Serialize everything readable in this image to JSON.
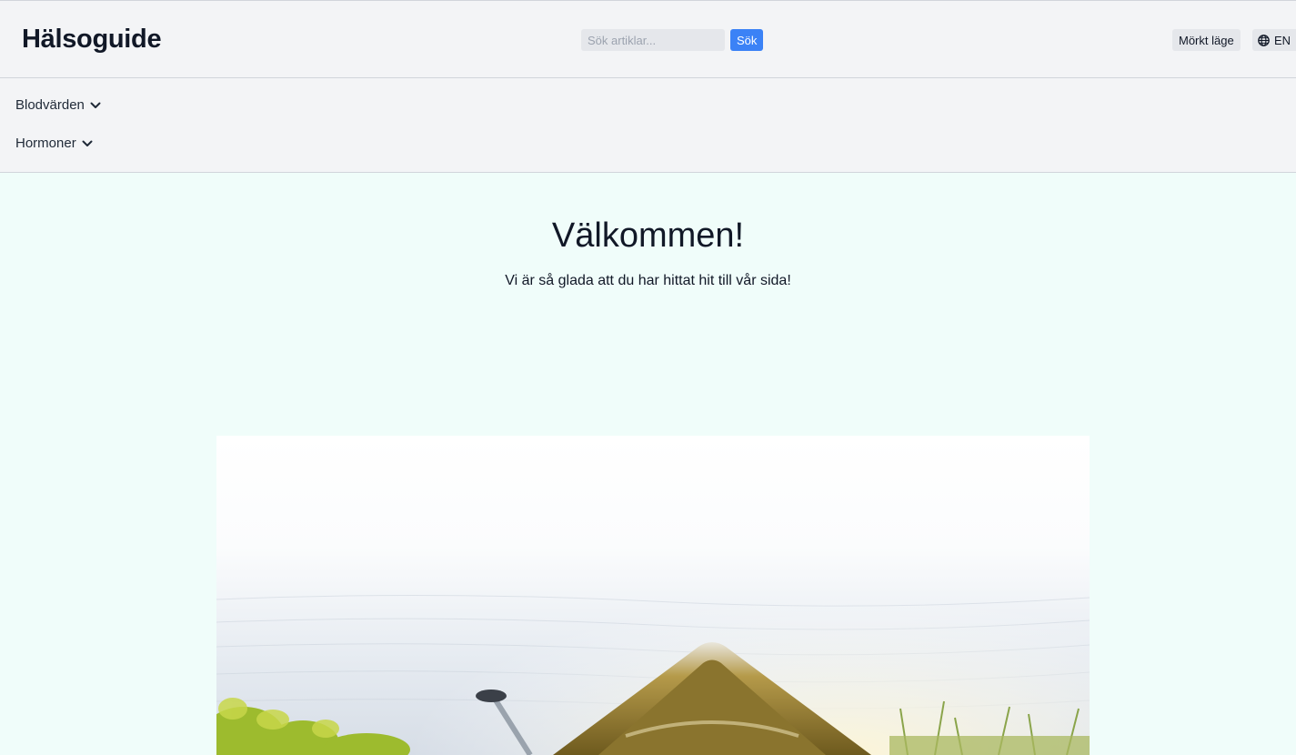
{
  "header": {
    "brand": "Hälsoguide",
    "search": {
      "placeholder": "Sök artiklar...",
      "button_label": "Sök"
    },
    "dark_mode_label": "Mörkt läge",
    "language_label": "EN"
  },
  "nav": {
    "items": [
      {
        "label": "Blodvärden"
      },
      {
        "label": "Hormoner"
      }
    ]
  },
  "hero": {
    "title": "Välkommen!",
    "subtitle": "Vi är så glada att du har hittat hit till vår sida!"
  },
  "colors": {
    "page_background": "#f0fdfa",
    "header_background": "#f3f4f6",
    "accent": "#3b82f6"
  },
  "icons": [
    "globe-icon",
    "chevron-down-icon"
  ]
}
